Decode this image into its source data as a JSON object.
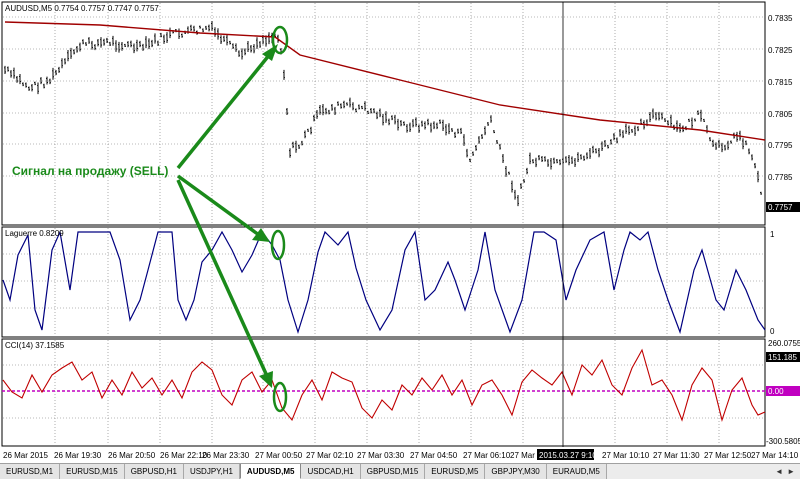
{
  "main_panel": {
    "title": "AUDUSD,M5  0.7754 0.7757 0.7747 0.7757",
    "price_labels": [
      "0.7835",
      "0.7825",
      "0.7815",
      "0.7805",
      "0.7795",
      "0.7785"
    ],
    "current_price": "0.7757",
    "annotation": "Сигнал на продажу (SELL)"
  },
  "laguerre_panel": {
    "title": "Laguerre 0.8209",
    "scale_top": "1",
    "scale_bottom": "0"
  },
  "cci_panel": {
    "title": "CCI(14) 37.1585",
    "scale_top": "260.0755",
    "current_value": "151.185",
    "zero_label": "0.00",
    "scale_bottom": "-300.5805"
  },
  "time_axis": {
    "labels": [
      "26 Mar 2015",
      "26 Mar 19:30",
      "26 Mar 20:50",
      "26 Mar 22:10",
      "26 Mar 23:30",
      "27 Mar 00:50",
      "27 Mar 02:10",
      "27 Mar 03:30",
      "27 Mar 04:50",
      "27 Mar 06:10",
      "27 Mar 07",
      "27 Mar 10:10",
      "27 Mar 11:30",
      "27 Mar 12:50",
      "27 Mar 14:10"
    ],
    "cursor_label": "2015.03.27 9:10"
  },
  "tabs": [
    {
      "label": "EURUSD,M1"
    },
    {
      "label": "EURUSD,M15"
    },
    {
      "label": "GBPUSD,H1"
    },
    {
      "label": "USDJPY,H1"
    },
    {
      "label": "AUDUSD,M5",
      "active": true
    },
    {
      "label": "USDCAD,H1"
    },
    {
      "label": "GBPUSD,M15"
    },
    {
      "label": "EURUSD,M5"
    },
    {
      "label": "GBPJPY,M30"
    },
    {
      "label": "EURAUD,M5"
    }
  ],
  "colors": {
    "price_bars": "#000000",
    "moving_average": "#a00000",
    "laguerre_line": "#000080",
    "cci_line": "#c00000",
    "zero_line": "#c000c0",
    "signal_marker": "#1a8a1a"
  }
}
